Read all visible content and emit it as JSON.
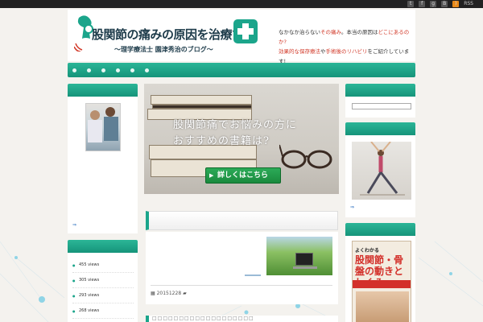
{
  "topbar": {
    "rss_label": "RSS"
  },
  "header": {
    "logo_title": "股関節の痛みの原因を治療する",
    "logo_subtitle": "〜理学療法士 園津秀治のブログ〜",
    "catch_line1_a": "なかなか治らない",
    "catch_line1_b": "その痛み",
    "catch_line1_c": "。本当の原因は",
    "catch_line1_d": "どこにあるのか?",
    "catch_line2_a": "効果的な保存療法",
    "catch_line2_b": "や",
    "catch_line2_c": "手術後のリハビリ",
    "catch_line2_d": "をご紹介しています!"
  },
  "colors": {
    "accent": "#1ba58b",
    "header_text": "#1d3b4a",
    "catch_red": "#d23a2a",
    "cta_green": "#2cab58"
  },
  "hero": {
    "line1": "股関節痛でお悩みの方に",
    "line2": "おすすめの書籍は?",
    "button_label": "詳しくはこちら"
  },
  "profile_widget": {
    "link": "⇒"
  },
  "popular_widget": {
    "items": [
      {
        "label": "455 views"
      },
      {
        "label": "305 views"
      },
      {
        "label": "293 views"
      },
      {
        "label": "268 views"
      },
      {
        "label": ""
      }
    ]
  },
  "article": {
    "date_icon": "calendar-icon",
    "date": "20151228",
    "category_icon": "folder-icon",
    "next_title": "□□□□□□□□□□□□□□□□□□□"
  },
  "right_widget2": {
    "link": "⇒"
  },
  "book_cover": {
    "top_text": "よくわかる",
    "title": "股関節・骨盤の動きとしくみ",
    "band_text": ""
  }
}
